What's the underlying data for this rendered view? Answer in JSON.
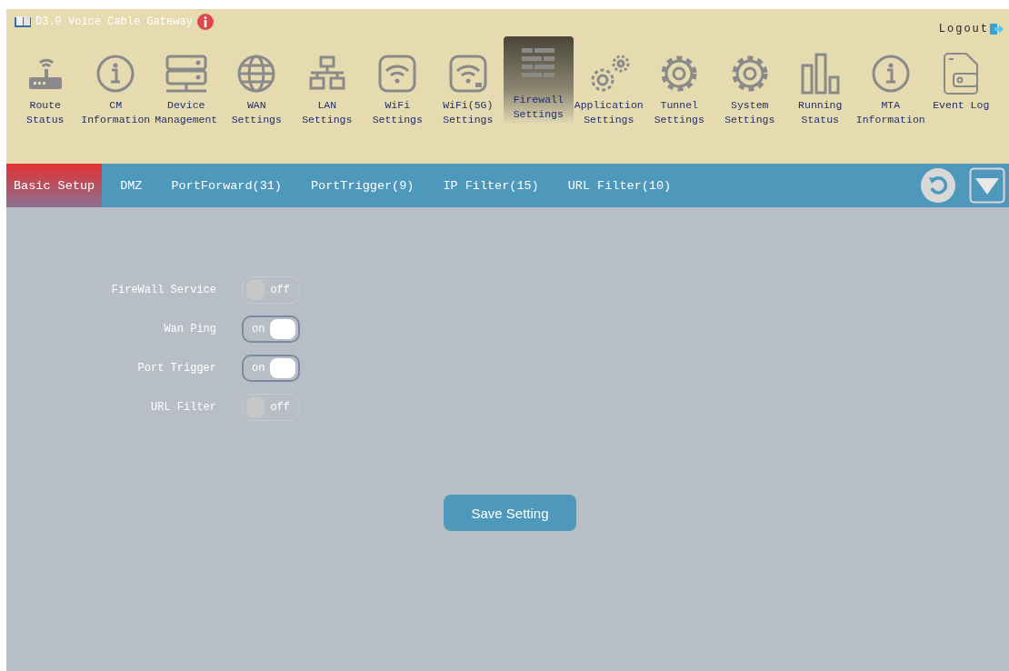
{
  "header": {
    "title": "D3.0 Voice Cable Gateway",
    "logout": "Logout"
  },
  "nav": [
    {
      "kind": "router",
      "lines": [
        "Route",
        "Status"
      ],
      "selected": false
    },
    {
      "kind": "info",
      "lines": [
        "CM",
        "Information"
      ],
      "selected": false
    },
    {
      "kind": "server",
      "lines": [
        "Device",
        "Management"
      ],
      "selected": false
    },
    {
      "kind": "globe",
      "lines": [
        "WAN",
        "Settings"
      ],
      "selected": false
    },
    {
      "kind": "lan",
      "lines": [
        "LAN",
        "Settings"
      ],
      "selected": false
    },
    {
      "kind": "wifi",
      "lines": [
        "WiFi",
        "Settings"
      ],
      "selected": false
    },
    {
      "kind": "wifi5g",
      "lines": [
        "WiFi(5G)",
        "Settings"
      ],
      "selected": false
    },
    {
      "kind": "firewall",
      "lines": [
        "Firewall",
        "Settings"
      ],
      "selected": true
    },
    {
      "kind": "gears",
      "lines": [
        "Application",
        "Settings"
      ],
      "selected": false
    },
    {
      "kind": "gear",
      "lines": [
        "Tunnel",
        "Settings"
      ],
      "selected": false
    },
    {
      "kind": "gear",
      "lines": [
        "System",
        "Settings"
      ],
      "selected": false
    },
    {
      "kind": "bars",
      "lines": [
        "Running",
        "Status"
      ],
      "selected": false
    },
    {
      "kind": "info",
      "lines": [
        "MTA",
        "Information"
      ],
      "selected": false
    },
    {
      "kind": "doc",
      "lines": [
        "Event Log"
      ],
      "selected": false
    }
  ],
  "tabs": [
    {
      "label": "Basic Setup",
      "selected": true
    },
    {
      "label": "DMZ",
      "selected": false
    },
    {
      "label": "PortForward(31)",
      "selected": false
    },
    {
      "label": "PortTrigger(9)",
      "selected": false
    },
    {
      "label": "IP Filter(15)",
      "selected": false
    },
    {
      "label": "URL Filter(10)",
      "selected": false
    }
  ],
  "settings": [
    {
      "label": "FireWall Service",
      "on": false,
      "text": "off"
    },
    {
      "label": "Wan Ping",
      "on": true,
      "text": "on"
    },
    {
      "label": "Port Trigger",
      "on": true,
      "text": "on"
    },
    {
      "label": "URL Filter",
      "on": false,
      "text": "off"
    }
  ],
  "save_button": "Save Setting"
}
